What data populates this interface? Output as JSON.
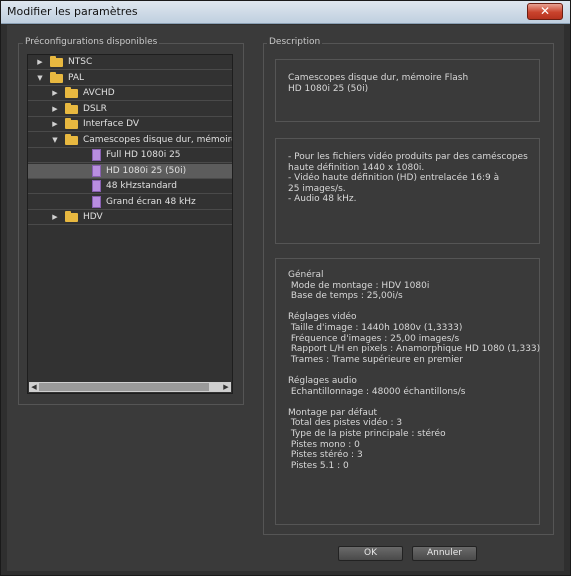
{
  "window": {
    "title": "Modifier les paramètres",
    "close_glyph": "✕"
  },
  "presets": {
    "label": "Préconfigurations disponibles",
    "rows": [
      {
        "label": "NTSC",
        "arrow": "▶",
        "icon": "folder-icon",
        "level": 0
      },
      {
        "label": "PAL",
        "arrow": "▼",
        "icon": "folder-icon",
        "level": 0
      },
      {
        "label": "AVCHD",
        "arrow": "▶",
        "icon": "folder-icon",
        "level": 1
      },
      {
        "label": "DSLR",
        "arrow": "▶",
        "icon": "folder-icon",
        "level": 1
      },
      {
        "label": "Interface DV",
        "arrow": "▶",
        "icon": "folder-icon",
        "level": 1
      },
      {
        "label": "Camescopes disque dur, mémoire Fl.",
        "arrow": "▼",
        "icon": "folder-icon",
        "level": 1
      },
      {
        "label": "Full HD 1080i 25",
        "arrow": "",
        "icon": "preset-file-icon",
        "level": 2
      },
      {
        "label": "HD 1080i 25 (50i)",
        "arrow": "",
        "icon": "preset-file-icon",
        "level": 2,
        "selected": true
      },
      {
        "label": "48 kHzstandard",
        "arrow": "",
        "icon": "preset-file-icon",
        "level": 2
      },
      {
        "label": "Grand écran 48 kHz",
        "arrow": "",
        "icon": "preset-file-icon",
        "level": 2
      },
      {
        "label": "HDV",
        "arrow": "▶",
        "icon": "folder-icon",
        "level": 1
      }
    ],
    "scroll_left": "◀",
    "scroll_right": "▶"
  },
  "description": {
    "label": "Description",
    "name_lines": [
      "Camescopes disque dur, mémoire Flash",
      "HD 1080i 25 (50i)"
    ],
    "notes": [
      "- Pour les fichiers vidéo produits par des caméscopes",
      "haute définition 1440 x 1080i.",
      "- Vidéo haute définition (HD) entrelacée 16:9 à",
      "25 images/s.",
      "- Audio 48 kHz."
    ],
    "summary": [
      "Général",
      " Mode de montage : HDV 1080i",
      " Base de temps : 25,00i/s",
      "",
      "Réglages vidéo",
      " Taille d'image : 1440h 1080v (1,3333)",
      " Fréquence d'images : 25,00 images/s",
      " Rapport L/H en pixels : Anamorphique HD 1080 (1,333)",
      " Trames : Trame supérieure en premier",
      "",
      "Réglages audio",
      " Echantillonnage : 48000 échantillons/s",
      "",
      "Montage par défaut",
      " Total des pistes vidéo : 3",
      " Type de la piste principale : stéréo",
      " Pistes mono : 0",
      " Pistes stéréo : 3",
      " Pistes 5.1 : 0"
    ]
  },
  "buttons": {
    "ok": "OK",
    "cancel": "Annuler"
  }
}
